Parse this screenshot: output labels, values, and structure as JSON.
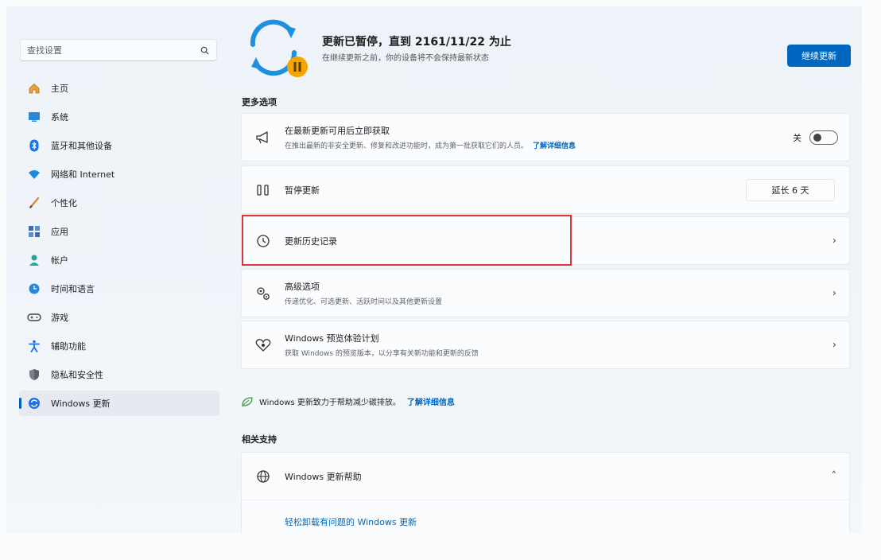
{
  "search": {
    "placeholder": "查找设置"
  },
  "sidebar": {
    "items": [
      {
        "label": "主页",
        "icon": "home-icon"
      },
      {
        "label": "系统",
        "icon": "system-icon"
      },
      {
        "label": "蓝牙和其他设备",
        "icon": "bluetooth-icon"
      },
      {
        "label": "网络和 Internet",
        "icon": "wifi-icon"
      },
      {
        "label": "个性化",
        "icon": "brush-icon"
      },
      {
        "label": "应用",
        "icon": "apps-icon"
      },
      {
        "label": "帐户",
        "icon": "account-icon"
      },
      {
        "label": "时间和语言",
        "icon": "globe-clock-icon"
      },
      {
        "label": "游戏",
        "icon": "gamepad-icon"
      },
      {
        "label": "辅助功能",
        "icon": "accessibility-icon"
      },
      {
        "label": "隐私和安全性",
        "icon": "shield-icon"
      },
      {
        "label": "Windows 更新",
        "icon": "windows-update-icon",
        "active": true
      }
    ]
  },
  "hero": {
    "title": "更新已暂停，直到 2161/11/22 为止",
    "subtitle": "在继续更新之前，你的设备将不会保持最新状态",
    "resume_label": "继续更新"
  },
  "more_options": {
    "label": "更多选项",
    "latest_updates": {
      "title": "在最新更新可用后立即获取",
      "desc": "在推出最新的非安全更新、修复和改进功能时，成为第一批获取它们的人员。",
      "link": "了解详细信息",
      "toggle_label": "关",
      "toggle_on": false
    },
    "pause": {
      "title": "暂停更新",
      "select_value": "延长 6 天"
    },
    "history": {
      "title": "更新历史记录"
    },
    "advanced": {
      "title": "高级选项",
      "desc": "传递优化、可选更新、活跃时间以及其他更新设置"
    },
    "insider": {
      "title": "Windows 预览体验计划",
      "desc": "获取 Windows 的预览版本，以分享有关新功能和更新的反馈"
    }
  },
  "carbon": {
    "text": "Windows 更新致力于帮助减少碳排放。",
    "link": "了解详细信息"
  },
  "related": {
    "label": "相关支持",
    "help_title": "Windows 更新帮助",
    "help_link": "轻松卸载有问题的 Windows 更新"
  },
  "colors": {
    "accent": "#0067c0",
    "highlight": "#d9363e",
    "pause_badge": "#f5a500",
    "sync_blue": "#1f8fe0"
  }
}
